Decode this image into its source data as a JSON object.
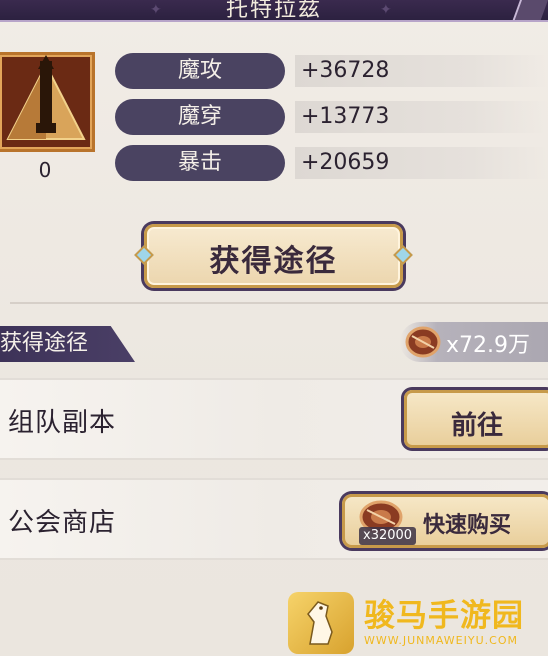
{
  "window": {
    "title": "托特拉兹"
  },
  "item": {
    "count": "0",
    "icon": "pyramid-spear-icon"
  },
  "stats": [
    {
      "label": "魔攻",
      "value": "+36728"
    },
    {
      "label": "魔穿",
      "value": "+13773"
    },
    {
      "label": "暴击",
      "value": "+20659"
    }
  ],
  "obtain_button": {
    "label": "获得途径"
  },
  "section": {
    "title": "获得途径"
  },
  "currency": {
    "amount": "x72.9万",
    "icon": "coin-icon"
  },
  "sources": [
    {
      "name": "组队副本",
      "button_label": "前往"
    },
    {
      "name": "公会商店",
      "button_label": "快速购买",
      "price": "x32000"
    }
  ],
  "watermark": {
    "brand": "骏马手游园",
    "url": "WWW.JUNMAWEIYU.COM"
  },
  "colors": {
    "title_bar": "#2c2140",
    "stat_pill": "#4a4361",
    "button_fill": "#ecd6ae",
    "button_border": "#c79a4a",
    "watermark": "#f0b81e"
  }
}
